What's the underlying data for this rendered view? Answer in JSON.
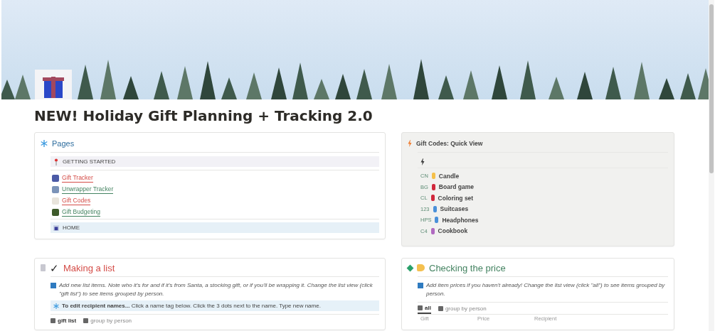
{
  "title": "NEW! Holiday Gift Planning + Tracking 2.0",
  "pages": {
    "heading": "Pages",
    "pinned": "GETTING STARTED",
    "links": [
      {
        "label": "Gift Tracker",
        "color": "#d44c47"
      },
      {
        "label": "Unwrapper Tracker",
        "color": "#448361"
      },
      {
        "label": "Gift Codes",
        "color": "#d44c47"
      },
      {
        "label": "Gift Budgeting",
        "color": "#448361"
      }
    ],
    "home": "HOME"
  },
  "quick_view": {
    "heading": "Gift Codes: Quick View",
    "codes": [
      {
        "code": "CN",
        "name": "Candle"
      },
      {
        "code": "BG",
        "name": "Board game"
      },
      {
        "code": "CL",
        "name": "Coloring set"
      },
      {
        "code": "123",
        "name": "Suitcases"
      },
      {
        "code": "HPS",
        "name": "Headphones"
      },
      {
        "code": "C4",
        "name": "Cookbook"
      }
    ]
  },
  "making_list": {
    "heading": "Making a list",
    "check": "✓",
    "info": "Add new list items. Note who it's for and if it's from Santa, a stocking gift, or if you'll be wrapping it. Change the list view (click \"gift list\") to see items grouped by person.",
    "tip": "**To edit recipient names...** Click a name tag below. Click the 3 dots next to the name. Type new name.",
    "tabs": [
      {
        "label": "gift list",
        "selected": true
      },
      {
        "label": "group by person",
        "selected": false
      }
    ]
  },
  "checking_price": {
    "heading": "Checking the price",
    "info": "Add item prices if you haven't already! Change the list view (click \"all\") to see items grouped by person.",
    "tabs": [
      {
        "label": "all",
        "selected": true
      },
      {
        "label": "group by person",
        "selected": false
      }
    ],
    "columns": [
      "Gift",
      "Price",
      "Recipient"
    ]
  }
}
